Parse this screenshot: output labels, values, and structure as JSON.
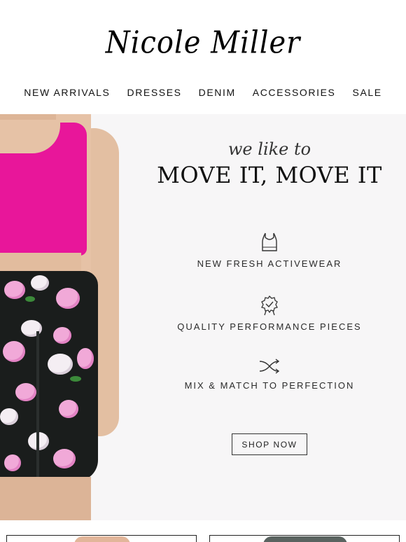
{
  "brand": {
    "logo_text": "Nicole Miller"
  },
  "nav": {
    "items": [
      "NEW ARRIVALS",
      "DRESSES",
      "DENIM",
      "ACCESSORIES",
      "SALE"
    ]
  },
  "hero": {
    "script_text": "we like to",
    "headline": "MOVE IT, MOVE IT",
    "features": [
      {
        "icon": "tank-top-icon",
        "label": "NEW FRESH ACTIVEWEAR"
      },
      {
        "icon": "award-badge-icon",
        "label": "QUALITY PERFORMANCE PIECES"
      },
      {
        "icon": "shuffle-icon",
        "label": "MIX & MATCH TO PERFECTION"
      }
    ],
    "cta_label": "SHOP NOW"
  },
  "colors": {
    "hero_background": "#f7f6f7",
    "top_pink": "#e8169a",
    "text_dark": "#111111"
  }
}
